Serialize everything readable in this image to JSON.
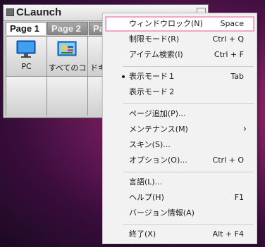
{
  "window": {
    "title": "CLaunch",
    "tabs": [
      {
        "label": "Page 1"
      },
      {
        "label": "Page 2"
      },
      {
        "label": "Page"
      }
    ],
    "items": [
      {
        "label": "PC",
        "icon": "monitor-icon"
      },
      {
        "label": "すべてのコ",
        "icon": "control-panel-icon"
      },
      {
        "label": "ドキ",
        "icon": "documents-icon"
      }
    ]
  },
  "menu": {
    "items": [
      {
        "label": "ウィンドウロック(N)",
        "shortcut": "Space"
      },
      {
        "label": "制限モード(R)",
        "shortcut": "Ctrl + Q"
      },
      {
        "label": "アイテム検索(I)",
        "shortcut": "Ctrl + F"
      },
      {
        "label": "表示モード１",
        "shortcut": "Tab"
      },
      {
        "label": "表示モード２",
        "shortcut": ""
      },
      {
        "label": "ページ追加(P)...",
        "shortcut": ""
      },
      {
        "label": "メンテナンス(M)",
        "shortcut": ""
      },
      {
        "label": "スキン(S)...",
        "shortcut": ""
      },
      {
        "label": "オプション(O)...",
        "shortcut": "Ctrl + O"
      },
      {
        "label": "言語(L)...",
        "shortcut": ""
      },
      {
        "label": "ヘルプ(H)",
        "shortcut": "F1"
      },
      {
        "label": "バージョン情報(A)",
        "shortcut": ""
      },
      {
        "label": "終了(X)",
        "shortcut": "Alt + F4"
      }
    ],
    "submenu_arrow": "›",
    "bullet_item": "表示モード１"
  },
  "colors": {
    "highlight_border": "#f2a7c7",
    "menu_bg": "#f2f2f2",
    "desktop": "#6b1b59"
  }
}
